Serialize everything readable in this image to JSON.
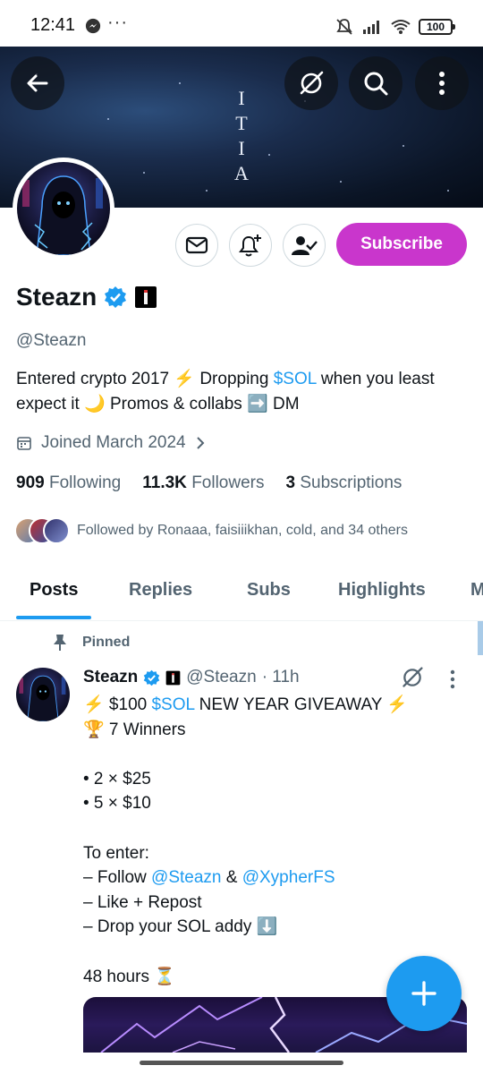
{
  "status_bar": {
    "time": "12:41",
    "dots": "···",
    "battery": "100"
  },
  "banner": {
    "vertical_text": [
      "I",
      "T",
      "I",
      "A"
    ]
  },
  "header_buttons": {
    "back": "back-icon",
    "grok": "grok-icon",
    "search": "search-icon",
    "more": "more-icon"
  },
  "profile": {
    "name": "Steazn",
    "handle": "@Steazn",
    "bio_part1": "Entered crypto 2017 ⚡️  Dropping ",
    "bio_cashtag": "$SOL",
    "bio_part2": " when you least expect it 🌙  Promos & collabs ➡️ DM",
    "joined": "Joined March 2024",
    "following_count": "909",
    "following_label": "Following",
    "followers_count": "11.3K",
    "followers_label": "Followers",
    "subscriptions_count": "3",
    "subscriptions_label": "Subscriptions",
    "followed_by": "Followed by Ronaaa, faisiiikhan, cold, and 34 others",
    "subscribe_label": "Subscribe"
  },
  "tabs": [
    {
      "label": "Posts"
    },
    {
      "label": "Replies"
    },
    {
      "label": "Subs"
    },
    {
      "label": "Highlights"
    },
    {
      "label": "M"
    }
  ],
  "post": {
    "pinned_label": "Pinned",
    "author": "Steazn",
    "handle": "@Steazn",
    "time": "· 11h",
    "line1_pre": "⚡️ $100 ",
    "line1_tag": "$SOL",
    "line1_post": " NEW YEAR GIVEAWAY ⚡️",
    "line2": "🏆 7 Winners",
    "line3": "• 2 × $25",
    "line4": "• 5 × $10",
    "line5": "To enter:",
    "line6_pre": "– Follow ",
    "line6_m1": "@Steazn",
    "line6_mid": " & ",
    "line6_m2": "@XypherFS",
    "line7": "– Like + Repost",
    "line8": "– Drop your SOL addy ⬇️",
    "line9": "48 hours ⏳"
  },
  "colors": {
    "accent": "#1d9bf0",
    "subscribe": "#c936cc",
    "muted": "#536471",
    "text": "#0f1419"
  }
}
